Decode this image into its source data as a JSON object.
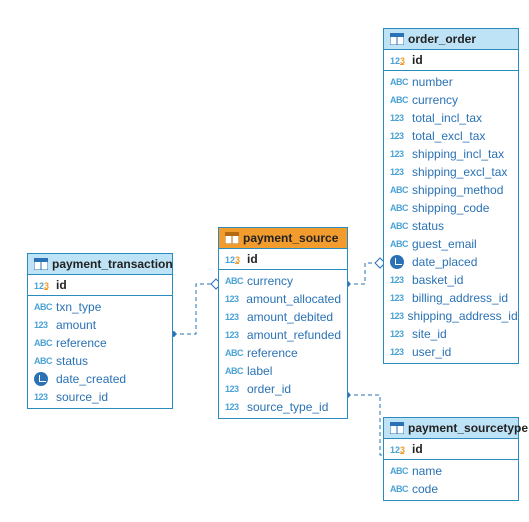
{
  "tables": {
    "payment_transaction": {
      "title": "payment_transaction",
      "pk": "id",
      "cols": [
        {
          "type": "abc",
          "name": "txn_type"
        },
        {
          "type": "num",
          "name": "amount"
        },
        {
          "type": "abc",
          "name": "reference"
        },
        {
          "type": "abc",
          "name": "status"
        },
        {
          "type": "date",
          "name": "date_created"
        },
        {
          "type": "num",
          "name": "source_id"
        }
      ]
    },
    "payment_source": {
      "title": "payment_source",
      "pk": "id",
      "cols": [
        {
          "type": "abc",
          "name": "currency"
        },
        {
          "type": "num",
          "name": "amount_allocated"
        },
        {
          "type": "num",
          "name": "amount_debited"
        },
        {
          "type": "num",
          "name": "amount_refunded"
        },
        {
          "type": "abc",
          "name": "reference"
        },
        {
          "type": "abc",
          "name": "label"
        },
        {
          "type": "num",
          "name": "order_id"
        },
        {
          "type": "num",
          "name": "source_type_id"
        }
      ]
    },
    "order_order": {
      "title": "order_order",
      "pk": "id",
      "cols": [
        {
          "type": "abc",
          "name": "number"
        },
        {
          "type": "abc",
          "name": "currency"
        },
        {
          "type": "num",
          "name": "total_incl_tax"
        },
        {
          "type": "num",
          "name": "total_excl_tax"
        },
        {
          "type": "num",
          "name": "shipping_incl_tax"
        },
        {
          "type": "num",
          "name": "shipping_excl_tax"
        },
        {
          "type": "abc",
          "name": "shipping_method"
        },
        {
          "type": "abc",
          "name": "shipping_code"
        },
        {
          "type": "abc",
          "name": "status"
        },
        {
          "type": "abc",
          "name": "guest_email"
        },
        {
          "type": "date",
          "name": "date_placed"
        },
        {
          "type": "num",
          "name": "basket_id"
        },
        {
          "type": "num",
          "name": "billing_address_id"
        },
        {
          "type": "num",
          "name": "shipping_address_id"
        },
        {
          "type": "num",
          "name": "site_id"
        },
        {
          "type": "num",
          "name": "user_id"
        }
      ]
    },
    "payment_sourcetype": {
      "title": "payment_sourcetype",
      "pk": "id",
      "cols": [
        {
          "type": "abc",
          "name": "name"
        },
        {
          "type": "abc",
          "name": "code"
        }
      ]
    }
  },
  "type_labels": {
    "abc": "ABC",
    "num": "123"
  },
  "chart_data": {
    "type": "er-diagram",
    "entities": [
      {
        "name": "payment_transaction",
        "primary_key": "id",
        "columns": [
          {
            "name": "txn_type",
            "dtype": "text"
          },
          {
            "name": "amount",
            "dtype": "numeric"
          },
          {
            "name": "reference",
            "dtype": "text"
          },
          {
            "name": "status",
            "dtype": "text"
          },
          {
            "name": "date_created",
            "dtype": "datetime"
          },
          {
            "name": "source_id",
            "dtype": "numeric",
            "fk": "payment_source.id"
          }
        ]
      },
      {
        "name": "payment_source",
        "primary_key": "id",
        "highlighted": true,
        "columns": [
          {
            "name": "currency",
            "dtype": "text"
          },
          {
            "name": "amount_allocated",
            "dtype": "numeric"
          },
          {
            "name": "amount_debited",
            "dtype": "numeric"
          },
          {
            "name": "amount_refunded",
            "dtype": "numeric"
          },
          {
            "name": "reference",
            "dtype": "text"
          },
          {
            "name": "label",
            "dtype": "text"
          },
          {
            "name": "order_id",
            "dtype": "numeric",
            "fk": "order_order.id"
          },
          {
            "name": "source_type_id",
            "dtype": "numeric",
            "fk": "payment_sourcetype.id"
          }
        ]
      },
      {
        "name": "order_order",
        "primary_key": "id",
        "columns": [
          {
            "name": "number",
            "dtype": "text"
          },
          {
            "name": "currency",
            "dtype": "text"
          },
          {
            "name": "total_incl_tax",
            "dtype": "numeric"
          },
          {
            "name": "total_excl_tax",
            "dtype": "numeric"
          },
          {
            "name": "shipping_incl_tax",
            "dtype": "numeric"
          },
          {
            "name": "shipping_excl_tax",
            "dtype": "numeric"
          },
          {
            "name": "shipping_method",
            "dtype": "text"
          },
          {
            "name": "shipping_code",
            "dtype": "text"
          },
          {
            "name": "status",
            "dtype": "text"
          },
          {
            "name": "guest_email",
            "dtype": "text"
          },
          {
            "name": "date_placed",
            "dtype": "datetime"
          },
          {
            "name": "basket_id",
            "dtype": "numeric"
          },
          {
            "name": "billing_address_id",
            "dtype": "numeric"
          },
          {
            "name": "shipping_address_id",
            "dtype": "numeric"
          },
          {
            "name": "site_id",
            "dtype": "numeric"
          },
          {
            "name": "user_id",
            "dtype": "numeric"
          }
        ]
      },
      {
        "name": "payment_sourcetype",
        "primary_key": "id",
        "columns": [
          {
            "name": "name",
            "dtype": "text"
          },
          {
            "name": "code",
            "dtype": "text"
          }
        ]
      }
    ],
    "relationships": [
      {
        "from": "payment_transaction.source_id",
        "to": "payment_source.id"
      },
      {
        "from": "payment_source.order_id",
        "to": "order_order.id"
      },
      {
        "from": "payment_source.source_type_id",
        "to": "payment_sourcetype.id"
      }
    ]
  }
}
